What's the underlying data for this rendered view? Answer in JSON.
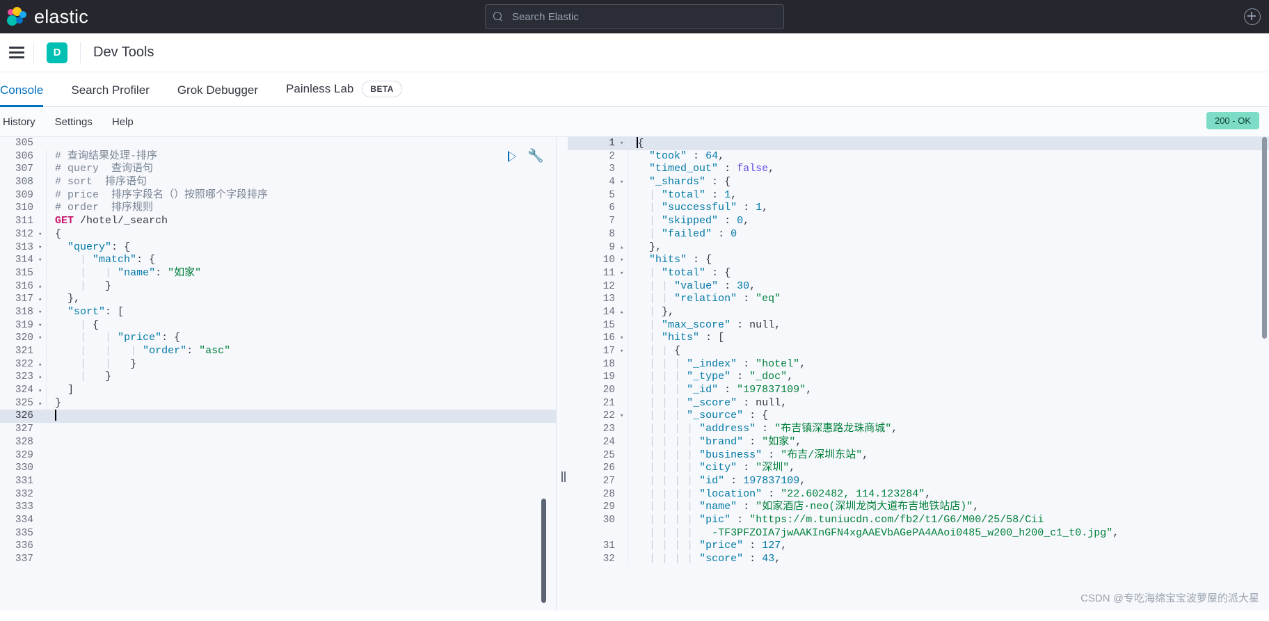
{
  "topbar": {
    "brand": "elastic",
    "logo_icon": "elastic-logo-icon",
    "search": {
      "placeholder": "Search Elastic",
      "value": "",
      "icon": "search-icon"
    },
    "help_icon": "help-circle-icon"
  },
  "breadcrumb": {
    "menu_icon": "hamburger-menu-icon",
    "app_badge": "D",
    "app_title": "Dev Tools"
  },
  "tabs": [
    {
      "label": "Console",
      "active": true,
      "badge": ""
    },
    {
      "label": "Search Profiler",
      "active": false,
      "badge": ""
    },
    {
      "label": "Grok Debugger",
      "active": false,
      "badge": ""
    },
    {
      "label": "Painless Lab",
      "active": false,
      "badge": "BETA"
    }
  ],
  "console_header": {
    "links": [
      "History",
      "Settings",
      "Help"
    ],
    "status": "200 - OK",
    "status_color": "#7ddcc5"
  },
  "actions": {
    "play_icon": "play-request-icon",
    "wrench_icon": "wrench-icon"
  },
  "editor": {
    "first_line": 305,
    "highlight_line": 326,
    "lines": [
      {
        "n": 305,
        "fold": "",
        "text": ""
      },
      {
        "n": 306,
        "fold": "",
        "text": "# 查询结果处理-排序",
        "cls": "t-com"
      },
      {
        "n": 307,
        "fold": "",
        "text": "# query  查询语句",
        "cls": "t-com"
      },
      {
        "n": 308,
        "fold": "",
        "text": "# sort  排序语句",
        "cls": "t-com"
      },
      {
        "n": 309,
        "fold": "",
        "text": "# price  排序字段名（）按照哪个字段排序",
        "cls": "t-com"
      },
      {
        "n": 310,
        "fold": "",
        "text": "# order  排序规则",
        "cls": "t-com"
      },
      {
        "n": 311,
        "fold": "",
        "method": "GET",
        "path": " /hotel/_search"
      },
      {
        "n": 312,
        "fold": "▾",
        "text": "{",
        "cls": "t-pun"
      },
      {
        "n": 313,
        "fold": "▾",
        "html": "  <span class=\"t-key\">\"query\"</span><span class=\"t-pun\">: {</span>"
      },
      {
        "n": 314,
        "fold": "▾",
        "html": "    <span class=\"ind\">|</span> <span class=\"t-key\">\"match\"</span><span class=\"t-pun\">: {</span>"
      },
      {
        "n": 315,
        "fold": "",
        "html": "    <span class=\"ind\">|</span>   <span class=\"ind\">|</span> <span class=\"t-key\">\"name\"</span><span class=\"t-pun\">: </span><span class=\"t-str\">\"如家\"</span>"
      },
      {
        "n": 316,
        "fold": "▴",
        "html": "    <span class=\"ind\">|</span>   <span class=\"t-pun\">}</span>"
      },
      {
        "n": 317,
        "fold": "▴",
        "html": "  <span class=\"t-pun\">},</span>"
      },
      {
        "n": 318,
        "fold": "▾",
        "html": "  <span class=\"t-key\">\"sort\"</span><span class=\"t-pun\">: [</span>"
      },
      {
        "n": 319,
        "fold": "▾",
        "html": "    <span class=\"ind\">|</span> <span class=\"t-pun\">{</span>"
      },
      {
        "n": 320,
        "fold": "▾",
        "html": "    <span class=\"ind\">|</span>   <span class=\"ind\">|</span> <span class=\"t-key\">\"price\"</span><span class=\"t-pun\">: {</span>"
      },
      {
        "n": 321,
        "fold": "",
        "html": "    <span class=\"ind\">|</span>   <span class=\"ind\">|</span>   <span class=\"ind\">|</span> <span class=\"t-key\">\"order\"</span><span class=\"t-pun\">: </span><span class=\"t-str\">\"asc\"</span>"
      },
      {
        "n": 322,
        "fold": "▴",
        "html": "    <span class=\"ind\">|</span>   <span class=\"ind\">|</span>   <span class=\"t-pun\">}</span>"
      },
      {
        "n": 323,
        "fold": "▴",
        "html": "    <span class=\"ind\">|</span>   <span class=\"t-pun\">}</span>"
      },
      {
        "n": 324,
        "fold": "▴",
        "html": "  <span class=\"t-pun\">]</span>"
      },
      {
        "n": 325,
        "fold": "▴",
        "html": "<span class=\"t-pun\">}</span>"
      },
      {
        "n": 326,
        "fold": "",
        "text": "",
        "cursor": true,
        "highlight": true
      },
      {
        "n": 327,
        "fold": "",
        "text": ""
      },
      {
        "n": 328,
        "fold": "",
        "text": ""
      },
      {
        "n": 329,
        "fold": "",
        "text": ""
      },
      {
        "n": 330,
        "fold": "",
        "text": ""
      },
      {
        "n": 331,
        "fold": "",
        "text": ""
      },
      {
        "n": 332,
        "fold": "",
        "text": ""
      },
      {
        "n": 333,
        "fold": "",
        "text": ""
      },
      {
        "n": 334,
        "fold": "",
        "text": ""
      },
      {
        "n": 335,
        "fold": "",
        "text": ""
      },
      {
        "n": 336,
        "fold": "",
        "text": ""
      },
      {
        "n": 337,
        "fold": "",
        "text": ""
      }
    ]
  },
  "response": {
    "lines": [
      {
        "n": 1,
        "fold": "▾",
        "html": "<span class=\"t-pun\">{</span>",
        "highlight": true,
        "cursor": true
      },
      {
        "n": 2,
        "fold": "",
        "html": "  <span class=\"t-key\">\"took\"</span> <span class=\"t-pun\">:</span> <span class=\"t-num\">64</span><span class=\"t-pun\">,</span>"
      },
      {
        "n": 3,
        "fold": "",
        "html": "  <span class=\"t-key\">\"timed_out\"</span> <span class=\"t-pun\">:</span> <span class=\"t-bool\">false</span><span class=\"t-pun\">,</span>"
      },
      {
        "n": 4,
        "fold": "▾",
        "html": "  <span class=\"t-key\">\"_shards\"</span> <span class=\"t-pun\">:</span> <span class=\"t-pun\">{</span>"
      },
      {
        "n": 5,
        "fold": "",
        "html": "  <span class=\"ind\">|</span> <span class=\"t-key\">\"total\"</span> <span class=\"t-pun\">:</span> <span class=\"t-num\">1</span><span class=\"t-pun\">,</span>"
      },
      {
        "n": 6,
        "fold": "",
        "html": "  <span class=\"ind\">|</span> <span class=\"t-key\">\"successful\"</span> <span class=\"t-pun\">:</span> <span class=\"t-num\">1</span><span class=\"t-pun\">,</span>"
      },
      {
        "n": 7,
        "fold": "",
        "html": "  <span class=\"ind\">|</span> <span class=\"t-key\">\"skipped\"</span> <span class=\"t-pun\">:</span> <span class=\"t-num\">0</span><span class=\"t-pun\">,</span>"
      },
      {
        "n": 8,
        "fold": "",
        "html": "  <span class=\"ind\">|</span> <span class=\"t-key\">\"failed\"</span> <span class=\"t-pun\">:</span> <span class=\"t-num\">0</span>"
      },
      {
        "n": 9,
        "fold": "▴",
        "html": "  <span class=\"t-pun\">},</span>"
      },
      {
        "n": 10,
        "fold": "▾",
        "html": "  <span class=\"t-key\">\"hits\"</span> <span class=\"t-pun\">:</span> <span class=\"t-pun\">{</span>"
      },
      {
        "n": 11,
        "fold": "▾",
        "html": "  <span class=\"ind\">|</span> <span class=\"t-key\">\"total\"</span> <span class=\"t-pun\">:</span> <span class=\"t-pun\">{</span>"
      },
      {
        "n": 12,
        "fold": "",
        "html": "  <span class=\"ind\">|</span> <span class=\"ind\">|</span> <span class=\"t-key\">\"value\"</span> <span class=\"t-pun\">:</span> <span class=\"t-num\">30</span><span class=\"t-pun\">,</span>"
      },
      {
        "n": 13,
        "fold": "",
        "html": "  <span class=\"ind\">|</span> <span class=\"ind\">|</span> <span class=\"t-key\">\"relation\"</span> <span class=\"t-pun\">:</span> <span class=\"t-str\">\"eq\"</span>"
      },
      {
        "n": 14,
        "fold": "▴",
        "html": "  <span class=\"ind\">|</span> <span class=\"t-pun\">},</span>"
      },
      {
        "n": 15,
        "fold": "",
        "html": "  <span class=\"ind\">|</span> <span class=\"t-key\">\"max_score\"</span> <span class=\"t-pun\">:</span> <span class=\"t-null\">null</span><span class=\"t-pun\">,</span>"
      },
      {
        "n": 16,
        "fold": "▾",
        "html": "  <span class=\"ind\">|</span> <span class=\"t-key\">\"hits\"</span> <span class=\"t-pun\">:</span> <span class=\"t-pun\">[</span>"
      },
      {
        "n": 17,
        "fold": "▾",
        "html": "  <span class=\"ind\">|</span> <span class=\"ind\">|</span> <span class=\"t-pun\">{</span>"
      },
      {
        "n": 18,
        "fold": "",
        "html": "  <span class=\"ind\">|</span> <span class=\"ind\">|</span> <span class=\"ind\">|</span> <span class=\"t-key\">\"_index\"</span> <span class=\"t-pun\">:</span> <span class=\"t-str\">\"hotel\"</span><span class=\"t-pun\">,</span>"
      },
      {
        "n": 19,
        "fold": "",
        "html": "  <span class=\"ind\">|</span> <span class=\"ind\">|</span> <span class=\"ind\">|</span> <span class=\"t-key\">\"_type\"</span> <span class=\"t-pun\">:</span> <span class=\"t-str\">\"_doc\"</span><span class=\"t-pun\">,</span>"
      },
      {
        "n": 20,
        "fold": "",
        "html": "  <span class=\"ind\">|</span> <span class=\"ind\">|</span> <span class=\"ind\">|</span> <span class=\"t-key\">\"_id\"</span> <span class=\"t-pun\">:</span> <span class=\"t-str\">\"197837109\"</span><span class=\"t-pun\">,</span>"
      },
      {
        "n": 21,
        "fold": "",
        "html": "  <span class=\"ind\">|</span> <span class=\"ind\">|</span> <span class=\"ind\">|</span> <span class=\"t-key\">\"_score\"</span> <span class=\"t-pun\">:</span> <span class=\"t-null\">null</span><span class=\"t-pun\">,</span>"
      },
      {
        "n": 22,
        "fold": "▾",
        "html": "  <span class=\"ind\">|</span> <span class=\"ind\">|</span> <span class=\"ind\">|</span> <span class=\"t-key\">\"_source\"</span> <span class=\"t-pun\">:</span> <span class=\"t-pun\">{</span>"
      },
      {
        "n": 23,
        "fold": "",
        "html": "  <span class=\"ind\">|</span> <span class=\"ind\">|</span> <span class=\"ind\">|</span> <span class=\"ind\">|</span> <span class=\"t-key\">\"address\"</span> <span class=\"t-pun\">:</span> <span class=\"t-str\">\"布吉镇深惠路龙珠商城\"</span><span class=\"t-pun\">,</span>"
      },
      {
        "n": 24,
        "fold": "",
        "html": "  <span class=\"ind\">|</span> <span class=\"ind\">|</span> <span class=\"ind\">|</span> <span class=\"ind\">|</span> <span class=\"t-key\">\"brand\"</span> <span class=\"t-pun\">:</span> <span class=\"t-str\">\"如家\"</span><span class=\"t-pun\">,</span>"
      },
      {
        "n": 25,
        "fold": "",
        "html": "  <span class=\"ind\">|</span> <span class=\"ind\">|</span> <span class=\"ind\">|</span> <span class=\"ind\">|</span> <span class=\"t-key\">\"business\"</span> <span class=\"t-pun\">:</span> <span class=\"t-str\">\"布吉/深圳东站\"</span><span class=\"t-pun\">,</span>"
      },
      {
        "n": 26,
        "fold": "",
        "html": "  <span class=\"ind\">|</span> <span class=\"ind\">|</span> <span class=\"ind\">|</span> <span class=\"ind\">|</span> <span class=\"t-key\">\"city\"</span> <span class=\"t-pun\">:</span> <span class=\"t-str\">\"深圳\"</span><span class=\"t-pun\">,</span>"
      },
      {
        "n": 27,
        "fold": "",
        "html": "  <span class=\"ind\">|</span> <span class=\"ind\">|</span> <span class=\"ind\">|</span> <span class=\"ind\">|</span> <span class=\"t-key\">\"id\"</span> <span class=\"t-pun\">:</span> <span class=\"t-num\">197837109</span><span class=\"t-pun\">,</span>"
      },
      {
        "n": 28,
        "fold": "",
        "html": "  <span class=\"ind\">|</span> <span class=\"ind\">|</span> <span class=\"ind\">|</span> <span class=\"ind\">|</span> <span class=\"t-key\">\"location\"</span> <span class=\"t-pun\">:</span> <span class=\"t-str\">\"22.602482, 114.123284\"</span><span class=\"t-pun\">,</span>"
      },
      {
        "n": 29,
        "fold": "",
        "html": "  <span class=\"ind\">|</span> <span class=\"ind\">|</span> <span class=\"ind\">|</span> <span class=\"ind\">|</span> <span class=\"t-key\">\"name\"</span> <span class=\"t-pun\">:</span> <span class=\"t-str\">\"如家酒店·neo(深圳龙岗大道布吉地铁站店)\"</span><span class=\"t-pun\">,</span>"
      },
      {
        "n": 30,
        "fold": "",
        "html": "  <span class=\"ind\">|</span> <span class=\"ind\">|</span> <span class=\"ind\">|</span> <span class=\"ind\">|</span> <span class=\"t-key\">\"pic\"</span> <span class=\"t-pun\">:</span> <span class=\"t-str\">\"https://m.tuniucdn.com/fb2/t1/G6/M00/25/58/Cii</span>"
      },
      {
        "n": "",
        "fold": "",
        "html": "  <span class=\"ind\">|</span> <span class=\"ind\">|</span> <span class=\"ind\">|</span> <span class=\"ind\">|</span>   <span class=\"t-str\">-TF3PFZOIA7jwAAKInGFN4xgAAEVbAGePA4AAoi0485_w200_h200_c1_t0.jpg\"</span><span class=\"t-pun\">,</span>"
      },
      {
        "n": 31,
        "fold": "",
        "html": "  <span class=\"ind\">|</span> <span class=\"ind\">|</span> <span class=\"ind\">|</span> <span class=\"ind\">|</span> <span class=\"t-key\">\"price\"</span> <span class=\"t-pun\">:</span> <span class=\"t-num\">127</span><span class=\"t-pun\">,</span>"
      },
      {
        "n": 32,
        "fold": "",
        "html": "  <span class=\"ind\">|</span> <span class=\"ind\">|</span> <span class=\"ind\">|</span> <span class=\"ind\">|</span> <span class=\"t-key\">\"score\"</span> <span class=\"t-pun\">:</span> <span class=\"t-num\">43</span><span class=\"t-pun\">,</span>"
      }
    ]
  },
  "watermark": "CSDN @专吃海绵宝宝波萝屋的派大星"
}
